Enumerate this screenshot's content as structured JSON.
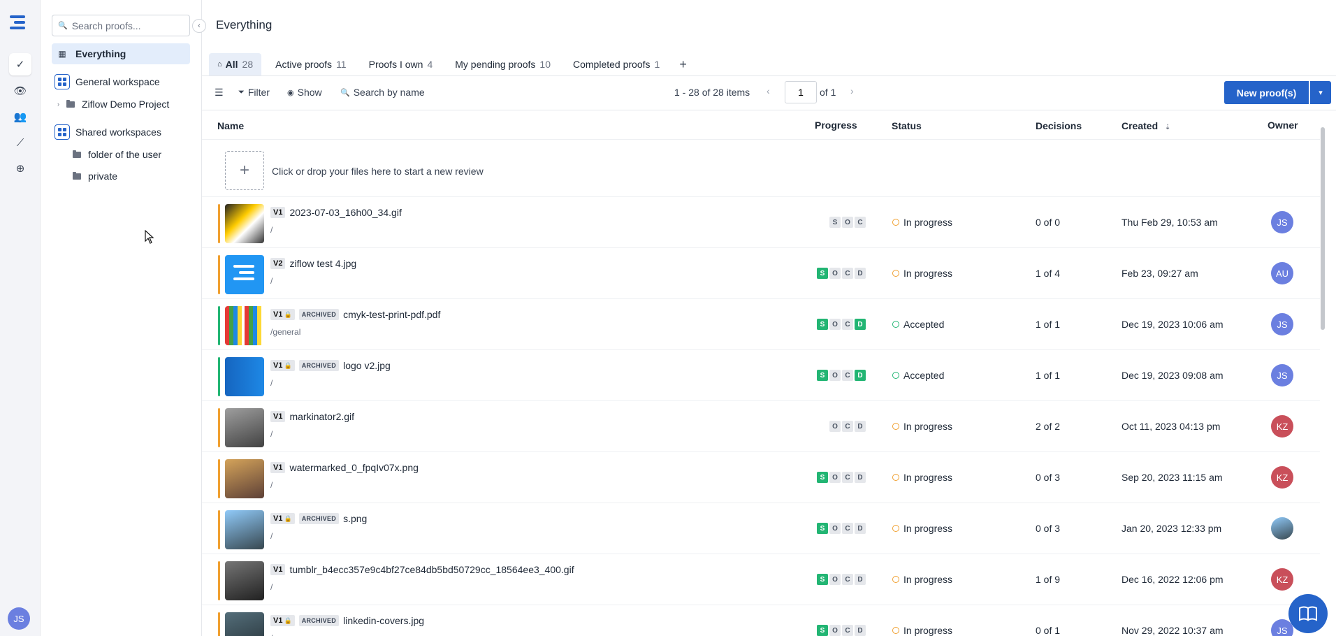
{
  "colors": {
    "accent": "#2563c9",
    "progress_green": "#22b573",
    "in_progress_orange": "#f0a030"
  },
  "rail": {
    "user_initials": "JS"
  },
  "sidebar": {
    "search_placeholder": "Search proofs...",
    "items": [
      {
        "label": "Everything"
      },
      {
        "label": "General workspace"
      },
      {
        "label": "Ziflow Demo Project"
      },
      {
        "label": "Shared workspaces"
      },
      {
        "label": "folder of the user"
      },
      {
        "label": "private"
      }
    ]
  },
  "main": {
    "title": "Everything",
    "tabs": [
      {
        "label": "All",
        "count": "28"
      },
      {
        "label": "Active proofs",
        "count": "11"
      },
      {
        "label": "Proofs I own",
        "count": "4"
      },
      {
        "label": "My pending proofs",
        "count": "10"
      },
      {
        "label": "Completed proofs",
        "count": "1"
      }
    ],
    "tab_add": "+",
    "toolbar": {
      "filter": "Filter",
      "show": "Show",
      "search": "Search by name",
      "items_summary": "1 - 28 of 28 items",
      "page": "1",
      "of_pages": "of 1",
      "new_proof": "New proof(s)"
    },
    "columns": {
      "name": "Name",
      "progress": "Progress",
      "status": "Status",
      "decisions": "Decisions",
      "created": "Created",
      "owner": "Owner"
    },
    "dropzone_text": "Click or drop your files here to start a new review",
    "rows": [
      {
        "version": "V1",
        "locked": false,
        "archived": false,
        "name": "2023-07-03_16h00_34.gif",
        "path": "/",
        "progress": [
          "S",
          "O",
          "C"
        ],
        "status": "In progress",
        "decisions": "0 of 0",
        "created": "Thu Feb 29, 10:53 am",
        "owner": "JS"
      },
      {
        "version": "V2",
        "locked": false,
        "archived": false,
        "name": "ziflow test 4.jpg",
        "path": "/",
        "progress": [
          "S",
          "O",
          "C",
          "D"
        ],
        "status": "In progress",
        "decisions": "1 of 4",
        "created": "Feb 23, 09:27 am",
        "owner": "AU"
      },
      {
        "version": "V1",
        "locked": true,
        "archived": true,
        "name": "cmyk-test-print-pdf.pdf",
        "path": "/general",
        "progress": [
          "S",
          "O",
          "C",
          "D"
        ],
        "status": "Accepted",
        "decisions": "1 of 1",
        "created": "Dec 19, 2023 10:06 am",
        "owner": "JS"
      },
      {
        "version": "V1",
        "locked": true,
        "archived": true,
        "name": "logo v2.jpg",
        "path": "/",
        "progress": [
          "S",
          "O",
          "C",
          "D"
        ],
        "status": "Accepted",
        "decisions": "1 of 1",
        "created": "Dec 19, 2023 09:08 am",
        "owner": "JS"
      },
      {
        "version": "V1",
        "locked": false,
        "archived": false,
        "name": "markinator2.gif",
        "path": "/",
        "progress": [
          "O",
          "C",
          "D"
        ],
        "status": "In progress",
        "decisions": "2 of 2",
        "created": "Oct 11, 2023 04:13 pm",
        "owner": "KZ"
      },
      {
        "version": "V1",
        "locked": false,
        "archived": false,
        "name": "watermarked_0_fpqIv07x.png",
        "path": "/",
        "progress": [
          "S",
          "O",
          "C",
          "D"
        ],
        "status": "In progress",
        "decisions": "0 of 3",
        "created": "Sep 20, 2023 11:15 am",
        "owner": "KZ"
      },
      {
        "version": "V1",
        "locked": true,
        "archived": true,
        "name": "s.png",
        "path": "/",
        "progress": [
          "S",
          "O",
          "C",
          "D"
        ],
        "status": "In progress",
        "decisions": "0 of 3",
        "created": "Jan 20, 2023 12:33 pm",
        "owner": ""
      },
      {
        "version": "V1",
        "locked": false,
        "archived": false,
        "name": "tumblr_b4ecc357e9c4bf27ce84db5bd50729cc_18564ee3_400.gif",
        "path": "/",
        "progress": [
          "S",
          "O",
          "C",
          "D"
        ],
        "status": "In progress",
        "decisions": "1 of 9",
        "created": "Dec 16, 2022 12:06 pm",
        "owner": "KZ"
      },
      {
        "version": "V1",
        "locked": true,
        "archived": true,
        "name": "linkedin-covers.jpg",
        "path": "/",
        "progress": [
          "S",
          "O",
          "C",
          "D"
        ],
        "status": "In progress",
        "decisions": "0 of 1",
        "created": "Nov 29, 2022 10:37 am",
        "owner": "JS"
      }
    ],
    "archived_label": "ARCHIVED"
  }
}
